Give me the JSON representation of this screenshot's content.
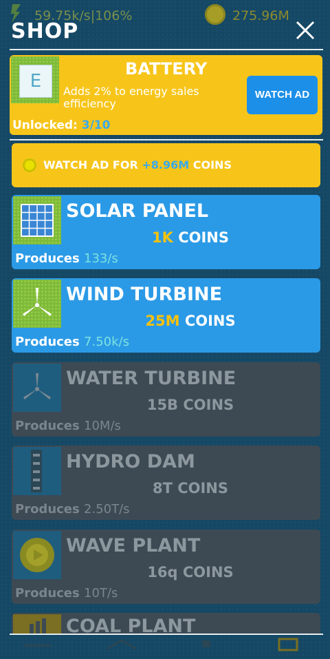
{
  "status_bar": {
    "energy_icon": "bolt-icon",
    "rate": "59.75k/s|106%",
    "coin_icon": "coin-icon",
    "coins": "275.96M"
  },
  "header": {
    "title": "SHOP",
    "close_icon": "close-icon"
  },
  "featured": {
    "thumb_letter": "E",
    "name": "BATTERY",
    "description": "Adds 2% to energy sales efficiency",
    "unlocked_label": "Unlocked:",
    "unlocked_value": "3/10",
    "button_label": "WATCH AD"
  },
  "ad_banner": {
    "prefix": "WATCH AD FOR",
    "amount": "+8.96M",
    "suffix": "COINS",
    "coin_icon": "coin-icon"
  },
  "items": [
    {
      "name": "SOLAR PANEL",
      "price": "1K",
      "unit": "COINS",
      "produces_label": "Produces",
      "produces": "133/s",
      "icon": "solar-panel-icon",
      "locked": false
    },
    {
      "name": "WIND TURBINE",
      "price": "25M",
      "unit": "COINS",
      "produces_label": "Produces",
      "produces": "7.50k/s",
      "icon": "wind-turbine-icon",
      "locked": false
    },
    {
      "name": "WATER TURBINE",
      "price": "15B",
      "unit": "COINS",
      "produces_label": "Produces",
      "produces": "10M/s",
      "icon": "water-turbine-icon",
      "locked": true
    },
    {
      "name": "HYDRO DAM",
      "price": "8T",
      "unit": "COINS",
      "produces_label": "Produces",
      "produces": "2.50T/s",
      "icon": "hydro-dam-icon",
      "locked": true
    },
    {
      "name": "WAVE PLANT",
      "price": "16q",
      "unit": "COINS",
      "produces_label": "Produces",
      "produces": "10T/s",
      "icon": "wave-plant-icon",
      "locked": true
    },
    {
      "name": "COAL PLANT",
      "icon": "coal-plant-icon",
      "locked": true
    }
  ],
  "colors": {
    "accent_yellow": "#f7c51a",
    "active_blue": "#2b9ae6",
    "locked_gray": "#3d4a54",
    "value_cyan": "#7ce2e0"
  }
}
